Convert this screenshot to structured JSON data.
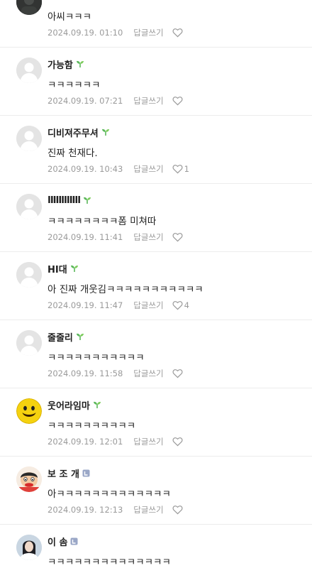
{
  "comments": [
    {
      "nickname": "",
      "text": "아씨ㅋㅋㅋ",
      "date": "2024.09.19. 01:10",
      "reply": "답글쓰기",
      "likes": "",
      "avatar": "dark-photo",
      "badge": "none"
    },
    {
      "nickname": "가능함",
      "text": "ㅋㅋㅋㅋㅋㅋ",
      "date": "2024.09.19. 07:21",
      "reply": "답글쓰기",
      "likes": "",
      "avatar": "default",
      "badge": "sprout"
    },
    {
      "nickname": "디비져주무셔",
      "text": "진짜 천재다.",
      "date": "2024.09.19. 10:43",
      "reply": "답글쓰기",
      "likes": "1",
      "avatar": "default",
      "badge": "sprout"
    },
    {
      "nickname": "IIIIIIIIIIII",
      "text": "ㅋㅋㅋㅋㅋㅋㅋㅋ폼 미쳐따",
      "date": "2024.09.19. 11:41",
      "reply": "답글쓰기",
      "likes": "",
      "avatar": "default",
      "badge": "sprout"
    },
    {
      "nickname": "HI대",
      "text": "아 진짜 개웃김ㅋㅋㅋㅋㅋㅋㅋㅋㅋㅋㅋ",
      "date": "2024.09.19. 11:47",
      "reply": "답글쓰기",
      "likes": "4",
      "avatar": "default",
      "badge": "sprout"
    },
    {
      "nickname": "줄줄리",
      "text": "ㅋㅋㅋㅋㅋㅋㅋㅋㅋㅋㅋ",
      "date": "2024.09.19. 11:58",
      "reply": "답글쓰기",
      "likes": "",
      "avatar": "default",
      "badge": "sprout"
    },
    {
      "nickname": "웃어라임마",
      "text": "ㅋㅋㅋㅋㅋㅋㅋㅋㅋㅋ",
      "date": "2024.09.19. 12:01",
      "reply": "답글쓰기",
      "likes": "",
      "avatar": "smiley",
      "badge": "sprout"
    },
    {
      "nickname": "보 조 개",
      "text": "아ㅋㅋㅋㅋㅋㅋㅋㅋㅋㅋㅋㅋㅋ",
      "date": "2024.09.19. 12:13",
      "reply": "답글쓰기",
      "likes": "",
      "avatar": "cartoon",
      "badge": "level"
    },
    {
      "nickname": "이 솜",
      "text": "ㅋㅋㅋㅋㅋㅋㅋㅋㅋㅋㅋㅋㅋㅋ",
      "date": "",
      "reply": "",
      "likes": "",
      "avatar": "person-photo",
      "badge": "level"
    }
  ],
  "colors": {
    "meta": "#9a9a9a",
    "divider": "#ececec",
    "sprout": "#5cb85c",
    "level_badge": "#9aa7c7"
  },
  "icons": {
    "like": "heart-outline-icon",
    "sprout_badge": "sprout-icon",
    "level_badge": "level-badge-icon",
    "default_avatar": "default-avatar-icon"
  }
}
